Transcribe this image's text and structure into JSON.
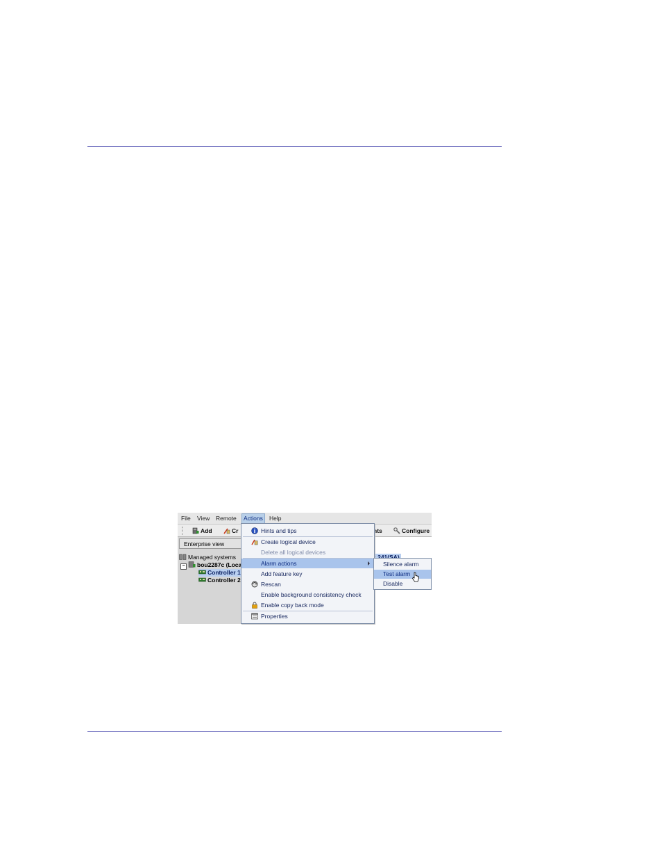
{
  "menubar": {
    "items": [
      {
        "label": "File"
      },
      {
        "label": "View"
      },
      {
        "label": "Remote"
      },
      {
        "label": "Actions"
      },
      {
        "label": "Help"
      }
    ]
  },
  "toolbar": {
    "add_label": "Add",
    "create_label_partial": "Cr",
    "events_label_partial": "nts",
    "configure_label": "Configure"
  },
  "left_pane": {
    "tab_label": "Enterprise view",
    "tree": [
      {
        "label": "Managed systems"
      },
      {
        "label": "bou2287c (Loca"
      },
      {
        "label": "Controller 1"
      },
      {
        "label": "Controller 2"
      }
    ]
  },
  "right_pane": {
    "header_partial": "c 241(SA)"
  },
  "actions_menu": {
    "items": [
      {
        "label": "Hints and tips",
        "icon": "info-icon"
      },
      {
        "label": "Create logical device",
        "icon": "create-device-icon"
      },
      {
        "label": "Delete all logical devices",
        "disabled": true
      },
      {
        "label": "Alarm actions",
        "submenu": true
      },
      {
        "label": "Add feature key"
      },
      {
        "label": "Rescan",
        "icon": "rescan-icon"
      },
      {
        "label": "Enable background consistency check"
      },
      {
        "label": "Enable copy back mode",
        "icon": "lock-icon"
      },
      {
        "label": "Properties",
        "icon": "properties-icon"
      }
    ]
  },
  "alarm_submenu": {
    "items": [
      {
        "label": "Silence alarm"
      },
      {
        "label": "Test alarm"
      },
      {
        "label": "Disable"
      }
    ]
  },
  "colors": {
    "highlight": "#a9c4ec",
    "rule": "#3a3aa8"
  }
}
